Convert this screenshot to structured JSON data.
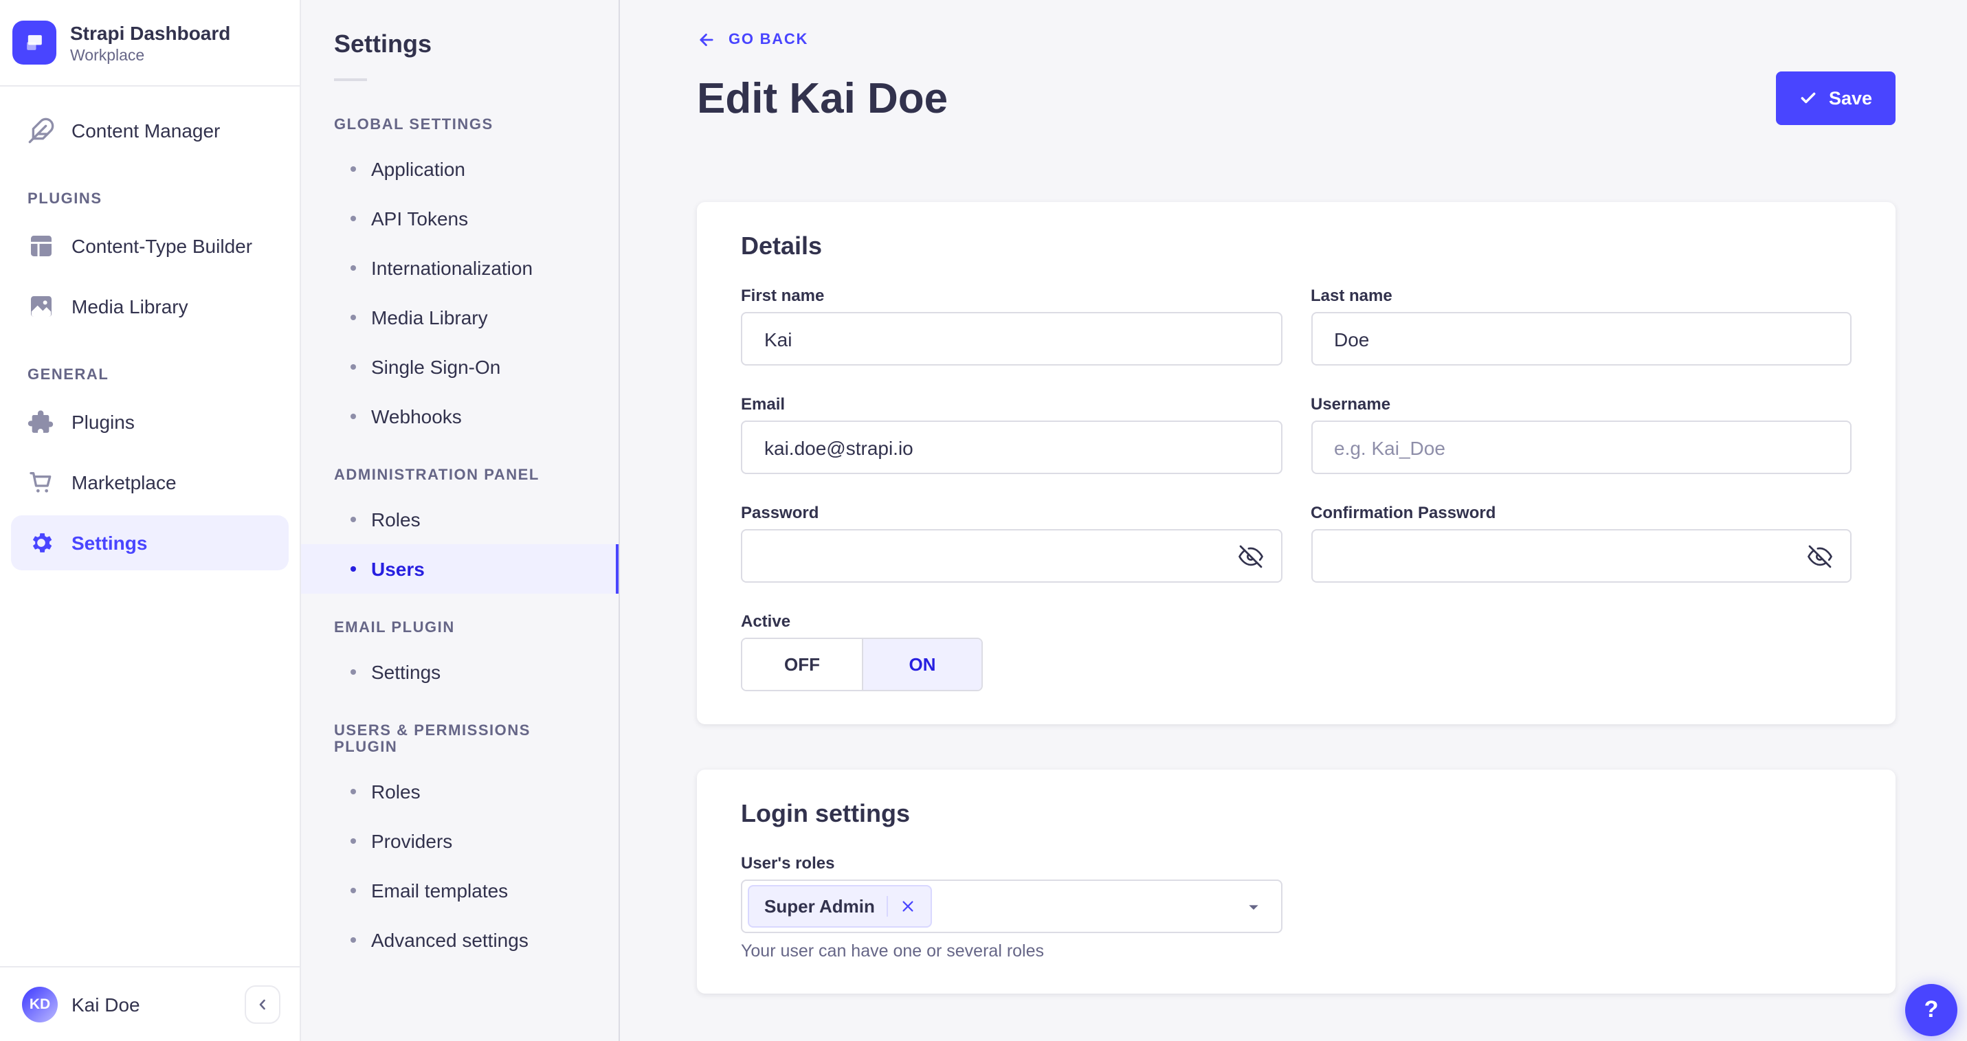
{
  "colors": {
    "primary": "#4945ff",
    "primary_active_text": "#271fe0",
    "primary_light_bg": "#f0f0ff",
    "text": "#32324d",
    "text_subtle": "#666687",
    "placeholder": "#8e8ea9",
    "border": "#dcdce4",
    "page_bg": "#f6f6f9"
  },
  "brand": {
    "title": "Strapi Dashboard",
    "subtitle": "Workplace"
  },
  "sidebar": {
    "main_items": [
      {
        "label": "Content Manager"
      }
    ],
    "sections": [
      {
        "title": "PLUGINS",
        "items": [
          {
            "label": "Content-Type Builder"
          },
          {
            "label": "Media Library"
          }
        ]
      },
      {
        "title": "GENERAL",
        "items": [
          {
            "label": "Plugins"
          },
          {
            "label": "Marketplace"
          },
          {
            "label": "Settings",
            "active": true
          }
        ]
      }
    ],
    "user": {
      "initials": "KD",
      "name": "Kai Doe"
    }
  },
  "subnav": {
    "title": "Settings",
    "sections": [
      {
        "title": "GLOBAL SETTINGS",
        "items": [
          {
            "label": "Application"
          },
          {
            "label": "API Tokens"
          },
          {
            "label": "Internationalization"
          },
          {
            "label": "Media Library"
          },
          {
            "label": "Single Sign-On"
          },
          {
            "label": "Webhooks"
          }
        ]
      },
      {
        "title": "ADMINISTRATION PANEL",
        "items": [
          {
            "label": "Roles"
          },
          {
            "label": "Users",
            "active": true
          }
        ]
      },
      {
        "title": "EMAIL PLUGIN",
        "items": [
          {
            "label": "Settings"
          }
        ]
      },
      {
        "title": "USERS & PERMISSIONS PLUGIN",
        "items": [
          {
            "label": "Roles"
          },
          {
            "label": "Providers"
          },
          {
            "label": "Email templates"
          },
          {
            "label": "Advanced settings"
          }
        ]
      }
    ]
  },
  "header": {
    "back_label": "GO BACK",
    "title": "Edit Kai Doe",
    "save_label": "Save"
  },
  "details": {
    "title": "Details",
    "fields": {
      "first_name": {
        "label": "First name",
        "value": "Kai"
      },
      "last_name": {
        "label": "Last name",
        "value": "Doe"
      },
      "email": {
        "label": "Email",
        "value": "kai.doe@strapi.io"
      },
      "username": {
        "label": "Username",
        "value": "",
        "placeholder": "e.g. Kai_Doe"
      },
      "password": {
        "label": "Password",
        "value": ""
      },
      "confirmation_password": {
        "label": "Confirmation Password",
        "value": ""
      },
      "active": {
        "label": "Active",
        "options": [
          "OFF",
          "ON"
        ],
        "value": "ON"
      }
    }
  },
  "login": {
    "title": "Login settings",
    "roles": {
      "label": "User's roles",
      "selected": [
        "Super Admin"
      ],
      "hint": "Your user can have one or several roles"
    }
  },
  "help": {
    "label": "?"
  }
}
